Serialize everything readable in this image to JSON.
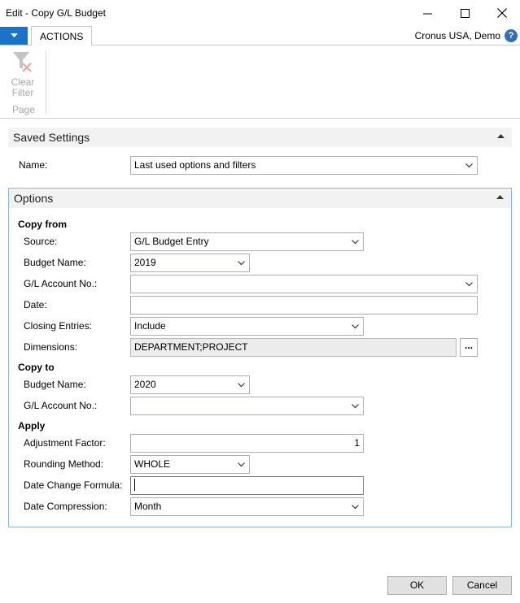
{
  "window": {
    "title": "Edit - Copy G/L Budget"
  },
  "tabs": {
    "actions_label": "ACTIONS"
  },
  "header": {
    "company": "Cronus USA, Demo",
    "help_glyph": "?"
  },
  "ribbon": {
    "clear_filter_line1": "Clear",
    "clear_filter_line2": "Filter",
    "group_label": "Page"
  },
  "saved_settings": {
    "title": "Saved Settings",
    "name_label": "Name:",
    "name_value": "Last used options and filters"
  },
  "options": {
    "title": "Options",
    "copy_from": {
      "heading": "Copy from",
      "source_label": "Source:",
      "source_value": "G/L Budget Entry",
      "budget_name_label": "Budget Name:",
      "budget_name_value": "2019",
      "gl_account_label": "G/L Account No.:",
      "gl_account_value": "",
      "date_label": "Date:",
      "date_value": "",
      "closing_entries_label": "Closing Entries:",
      "closing_entries_value": "Include",
      "dimensions_label": "Dimensions:",
      "dimensions_value": "DEPARTMENT;PROJECT",
      "dimensions_assist": "..."
    },
    "copy_to": {
      "heading": "Copy to",
      "budget_name_label": "Budget Name:",
      "budget_name_value": "2020",
      "gl_account_label": "G/L Account No.:",
      "gl_account_value": ""
    },
    "apply": {
      "heading": "Apply",
      "adjustment_factor_label": "Adjustment Factor:",
      "adjustment_factor_value": "1",
      "rounding_method_label": "Rounding Method:",
      "rounding_method_value": "WHOLE",
      "date_change_formula_label": "Date Change Formula:",
      "date_change_formula_value": "",
      "date_compression_label": "Date Compression:",
      "date_compression_value": "Month"
    }
  },
  "footer": {
    "ok_label": "OK",
    "cancel_label": "Cancel"
  },
  "colors": {
    "accent": "#1a73c8",
    "options_border": "#8ab4e4",
    "fasttab_header": "#f2f2f2",
    "disabled_field": "#ececec"
  }
}
